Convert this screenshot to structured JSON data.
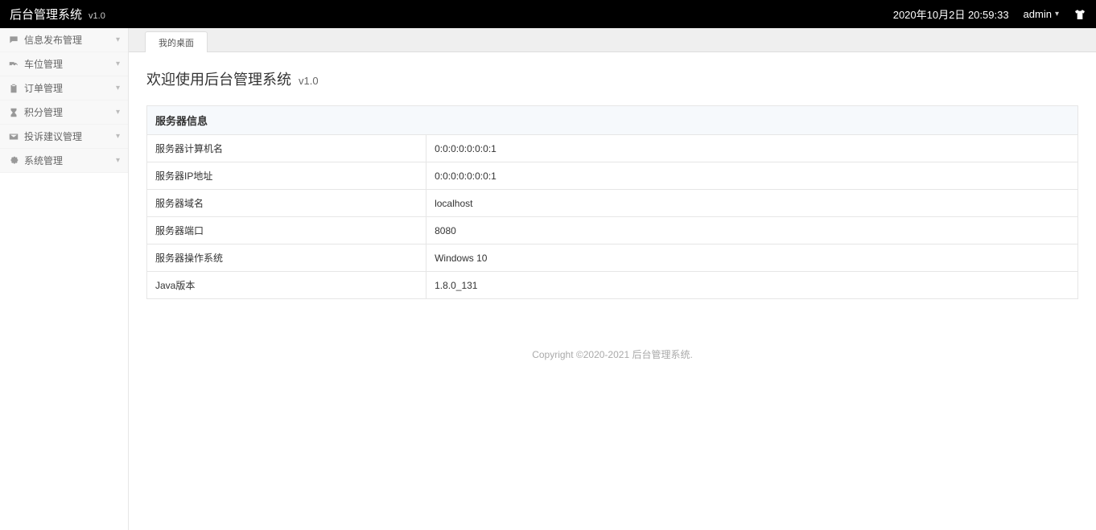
{
  "header": {
    "title": "后台管理系统",
    "version": "v1.0",
    "datetime": "2020年10月2日 20:59:33",
    "user": "admin"
  },
  "sidebar": {
    "items": [
      {
        "label": "信息发布管理",
        "icon": "comment"
      },
      {
        "label": "车位管理",
        "icon": "truck"
      },
      {
        "label": "订单管理",
        "icon": "clipboard"
      },
      {
        "label": "积分管理",
        "icon": "hourglass"
      },
      {
        "label": "投诉建议管理",
        "icon": "mail"
      },
      {
        "label": "系统管理",
        "icon": "gear"
      }
    ]
  },
  "tabs": [
    {
      "label": "我的桌面"
    }
  ],
  "welcome": {
    "text": "欢迎使用后台管理系统",
    "version": "v1.0"
  },
  "server_info": {
    "caption": "服务器信息",
    "rows": [
      {
        "label": "服务器计算机名",
        "value": "0:0:0:0:0:0:0:1"
      },
      {
        "label": "服务器IP地址",
        "value": "0:0:0:0:0:0:0:1"
      },
      {
        "label": "服务器域名",
        "value": "localhost"
      },
      {
        "label": "服务器端口",
        "value": "8080"
      },
      {
        "label": "服务器操作系统",
        "value": "Windows 10"
      },
      {
        "label": "Java版本",
        "value": "1.8.0_131"
      }
    ]
  },
  "footer": "Copyright ©2020-2021 后台管理系统."
}
